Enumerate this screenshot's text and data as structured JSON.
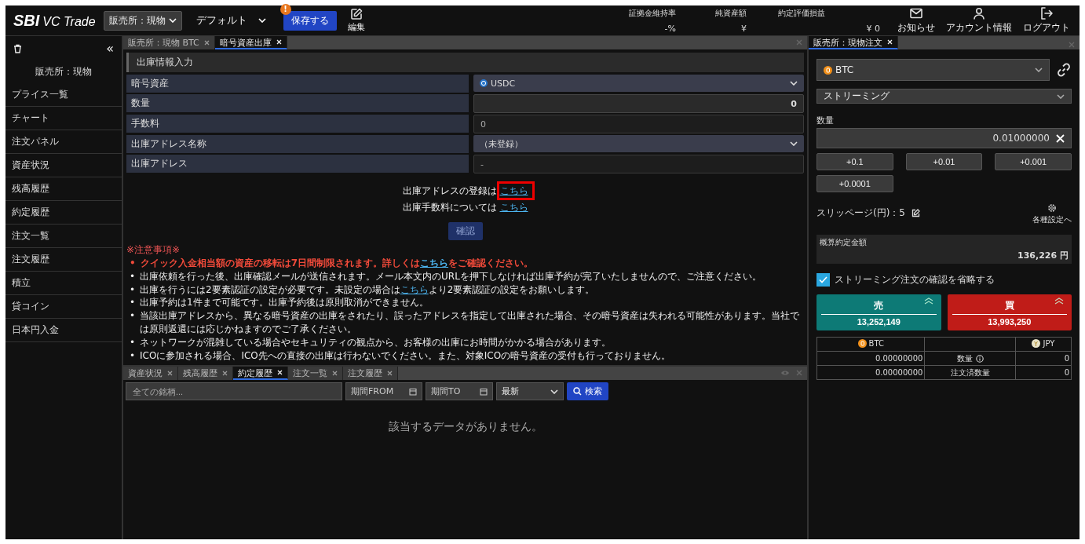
{
  "header": {
    "logo": {
      "mark": "SBI",
      "text": "VC Trade"
    },
    "market_select": "販売所：現物",
    "layout_select": "デフォルト",
    "save_button": {
      "label": "保存する",
      "badge": "!"
    },
    "edit_button": "編集",
    "stats": [
      {
        "label": "証拠金維持率",
        "value": "-%"
      },
      {
        "label": "純資産額",
        "value": "¥"
      },
      {
        "label": "約定評価損益",
        "value": "¥ 0"
      }
    ],
    "nav": [
      {
        "kind": "mail",
        "label": "お知らせ"
      },
      {
        "kind": "user",
        "label": "アカウント情報"
      },
      {
        "kind": "logout",
        "label": "ログアウト"
      }
    ]
  },
  "sidebar": {
    "collapse": "«",
    "title": "販売所：現物",
    "items": [
      "プライス一覧",
      "チャート",
      "注文パネル",
      "資産状況",
      "残高履歴",
      "約定履歴",
      "注文一覧",
      "注文履歴",
      "積立",
      "貸コイン",
      "日本円入金"
    ]
  },
  "main_tabs": [
    {
      "label": "販売所：現物 BTC",
      "selected": false
    },
    {
      "label": "暗号資産出庫",
      "selected": true
    }
  ],
  "form": {
    "title": "出庫情報入力",
    "rows": [
      {
        "label": "暗号資産",
        "kind": "coin_select",
        "value": "USDC"
      },
      {
        "label": "数量",
        "kind": "input",
        "value": "0"
      },
      {
        "label": "手数料",
        "kind": "readonly",
        "value": "0"
      },
      {
        "label": "出庫アドレス名称",
        "kind": "select",
        "value": "（未登録）"
      },
      {
        "label": "出庫アドレス",
        "kind": "readonly",
        "value": "-"
      }
    ]
  },
  "info_links": [
    {
      "text": "出庫アドレスの登録は",
      "link": "こちら",
      "highlighted": true
    },
    {
      "text": "出庫手数料については",
      "link": "こちら",
      "highlighted": false
    }
  ],
  "confirm_button": {
    "label": "確認",
    "disabled": true
  },
  "notes": {
    "title": "※注意事項※",
    "bullet": "•",
    "items": [
      {
        "kind": "warning",
        "parts": [
          {
            "text": "クイック入金相当額の資産の移転は7日間制限されます。詳しくは"
          },
          {
            "link": "こちら"
          },
          {
            "text": "をご確認ください。"
          }
        ]
      },
      {
        "kind": "normal",
        "parts": [
          {
            "text": "出庫依頼を行った後、出庫確認メールが送信されます。メール本文内のURLを押下しなければ出庫予約が完了いたしませんので、ご注意ください。"
          }
        ]
      },
      {
        "kind": "normal",
        "parts": [
          {
            "text": "出庫を行うには2要素認証の設定が必要です。未設定の場合は"
          },
          {
            "link": "こちら"
          },
          {
            "text": "より2要素認証の設定をお願いします。"
          }
        ]
      },
      {
        "kind": "normal",
        "parts": [
          {
            "text": "出庫予約は1件まで可能です。出庫予約後は原則取消ができません。"
          }
        ]
      },
      {
        "kind": "normal",
        "parts": [
          {
            "text": "当該出庫アドレスから、異なる暗号資産の出庫をされたり、誤ったアドレスを指定して出庫された場合、その暗号資産は失われる可能性があります。当社では原則返還には応じかねますのでご了承ください。"
          }
        ]
      },
      {
        "kind": "normal",
        "parts": [
          {
            "text": "ネットワークが混雑している場合やセキュリティの観点から、お客様の出庫にお時間がかかる場合があります。"
          }
        ]
      },
      {
        "kind": "normal",
        "parts": [
          {
            "text": "ICOに参加される場合、ICO先への直接の出庫は行わないでください。また、対象ICOの暗号資産の受付も行っておりません。"
          }
        ]
      }
    ]
  },
  "bottom_panel": {
    "tabs": [
      {
        "label": "資産状況",
        "selected": false
      },
      {
        "label": "残高履歴",
        "selected": false
      },
      {
        "label": "約定履歴",
        "selected": true
      },
      {
        "label": "注文一覧",
        "selected": false
      },
      {
        "label": "注文履歴",
        "selected": false
      }
    ],
    "search_placeholder": "全ての銘柄...",
    "date_from": "期間FROM",
    "date_to": "期間TO",
    "sort": "最新",
    "search_button": "検索",
    "empty_message": "該当するデータがありません。"
  },
  "order_panel": {
    "tab": {
      "label": "販売所：現物注文",
      "selected": true
    },
    "coin": "BTC",
    "order_type": "ストリーミング",
    "quantity_label": "数量",
    "quantity": "0.01000000",
    "increments": [
      "+0.1",
      "+0.01",
      "+0.001",
      "+0.0001"
    ],
    "slippage": "スリッページ(円)：5",
    "settings": "各種設定へ",
    "estimate_label": "概算約定金額",
    "estimate": "136,226 円",
    "skip_confirm": {
      "label": "ストリーミング注文の確認を省略する",
      "checked": true
    },
    "sell": {
      "label": "売",
      "price": "13,252,149"
    },
    "buy": {
      "label": "買",
      "price": "13,993,250"
    },
    "balance": {
      "columns": [
        "BTC",
        "JPY"
      ],
      "rows": [
        {
          "btc": "0.00000000",
          "label": "数量",
          "info": true,
          "jpy": "0"
        },
        {
          "btc": "0.00000000",
          "label": "注文済数量",
          "info": false,
          "jpy": "0"
        }
      ]
    }
  }
}
